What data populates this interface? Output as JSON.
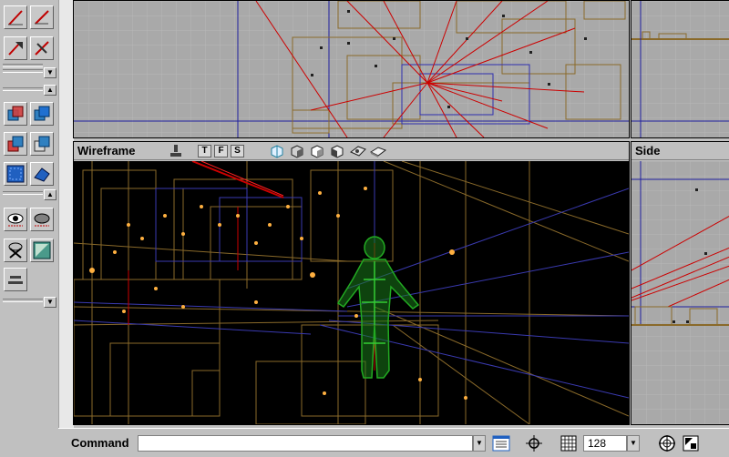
{
  "viewports": {
    "top": {
      "label": ""
    },
    "right_top": {
      "label": ""
    },
    "wireframe": {
      "label": "Wireframe",
      "view_buttons": [
        "T",
        "F",
        "S"
      ]
    },
    "side": {
      "label": "Side"
    }
  },
  "toolbar": {
    "icons": [
      "line-tool-icon",
      "diagonal-tool-icon",
      "vertex-tool-icon",
      "cut-tool-icon",
      "brush-add-icon",
      "brush-subtract-icon",
      "brush-intersect-icon",
      "brush-deintersect-icon",
      "select-box-icon",
      "camera-move-icon",
      "eye-show-icon",
      "eye-hide-icon",
      "delete-select-icon",
      "texture-icon",
      "align-icon"
    ]
  },
  "command": {
    "label": "Command",
    "value": "",
    "grid_size": "128"
  },
  "colors": {
    "viewport_bg": "#a9a9a9",
    "wire_bg": "#000000",
    "brush_outline": "#8a6a2a",
    "light_line": "#cc0000",
    "player_mesh": "#22aa22"
  }
}
